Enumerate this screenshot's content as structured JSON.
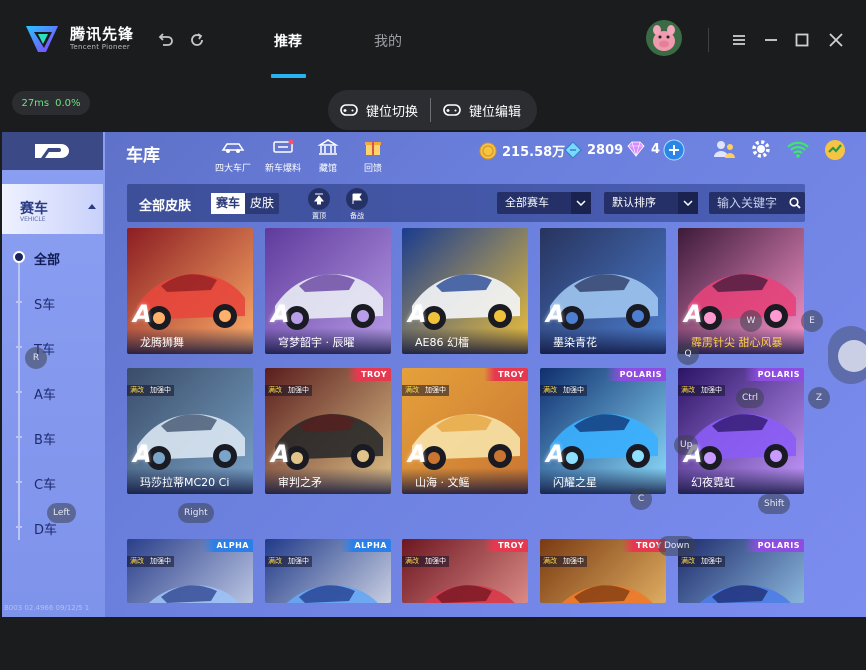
{
  "app": {
    "brand_cn": "腾讯先锋",
    "brand_en": "Tencent Pioneer",
    "accent_color": "#2ab1f0"
  },
  "nav": {
    "tabs": [
      {
        "label": "推荐",
        "active": true
      },
      {
        "label": "我的",
        "active": false
      }
    ]
  },
  "status": {
    "latency": "27ms",
    "loss": "0.0%"
  },
  "keymap": {
    "switch_label": "键位切换",
    "edit_label": "键位编辑"
  },
  "game": {
    "sidebar": {
      "category_title": "赛车",
      "category_en": "VEHICLE",
      "items": [
        {
          "label": "全部",
          "active": true
        },
        {
          "label": "S车",
          "active": false
        },
        {
          "label": "T车",
          "active": false
        },
        {
          "label": "A车",
          "active": false
        },
        {
          "label": "B车",
          "active": false
        },
        {
          "label": "C车",
          "active": false
        },
        {
          "label": "D车",
          "active": false
        }
      ]
    },
    "header": {
      "title": "车库",
      "icons": [
        {
          "label": "四大车厂",
          "icon": "car-factory-icon"
        },
        {
          "label": "新车爆料",
          "icon": "new-car-icon"
        },
        {
          "label": "藏馆",
          "icon": "museum-icon"
        },
        {
          "label": "回馈",
          "icon": "gift-icon"
        }
      ],
      "coins": "215.58万",
      "vouchers": "2809",
      "diamonds": "4"
    },
    "filter": {
      "title": "全部皮肤",
      "segments": [
        {
          "label": "赛车",
          "active": true
        },
        {
          "label": "皮肤",
          "active": false
        }
      ],
      "pin_label": "置顶",
      "backup_label": "备战",
      "car_select": "全部赛车",
      "sort_select": "默认排序",
      "search_placeholder": "输入关键字"
    },
    "cards": [
      {
        "name": "龙腾狮舞",
        "grade": "A",
        "tags": [],
        "brand": ""
      },
      {
        "name": "穹梦韶宇 · 辰曜",
        "grade": "A",
        "tags": [],
        "brand": ""
      },
      {
        "name": "AE86 幻檑",
        "grade": "A",
        "tags": [],
        "brand": ""
      },
      {
        "name": "墨染青花",
        "grade": "A",
        "tags": [],
        "brand": ""
      },
      {
        "name": "霹雳针尖  甜心风暴",
        "grade": "A",
        "tags": [],
        "brand": ""
      },
      {
        "name": "玛莎拉蒂MC20 Ci",
        "grade": "A",
        "tags": [
          "满改",
          "加强中"
        ],
        "brand": ""
      },
      {
        "name": "审判之矛",
        "grade": "A",
        "tags": [
          "满改",
          "加强中"
        ],
        "brand": "TROY"
      },
      {
        "name": "山海 · 文鳐",
        "grade": "A",
        "tags": [
          "满改",
          "加强中"
        ],
        "brand": "TROY"
      },
      {
        "name": "闪耀之星",
        "grade": "A",
        "tags": [
          "满改",
          "加强中"
        ],
        "brand": "POLARIS"
      },
      {
        "name": "幻夜霓虹",
        "grade": "A",
        "tags": [
          "满改",
          "加强中"
        ],
        "brand": "POLARIS"
      },
      {
        "name": "",
        "grade": "",
        "tags": [
          "满改",
          "加强中"
        ],
        "brand": "ALPHA"
      },
      {
        "name": "",
        "grade": "",
        "tags": [
          "满改",
          "加强中"
        ],
        "brand": "ALPHA"
      },
      {
        "name": "",
        "grade": "",
        "tags": [
          "满改",
          "加强中"
        ],
        "brand": "TROY"
      },
      {
        "name": "",
        "grade": "",
        "tags": [
          "满改",
          "加强中"
        ],
        "brand": "TROY"
      },
      {
        "name": "",
        "grade": "",
        "tags": [
          "满改",
          "加强中"
        ],
        "brand": "POLARIS"
      }
    ],
    "overlay_keys": [
      "R",
      "Left",
      "Right",
      "W",
      "E",
      "Q",
      "Ctrl",
      "Up",
      "Z",
      "C",
      "Shift",
      "Down"
    ],
    "build_text": "B003 02.4966 09/12/5 1"
  }
}
